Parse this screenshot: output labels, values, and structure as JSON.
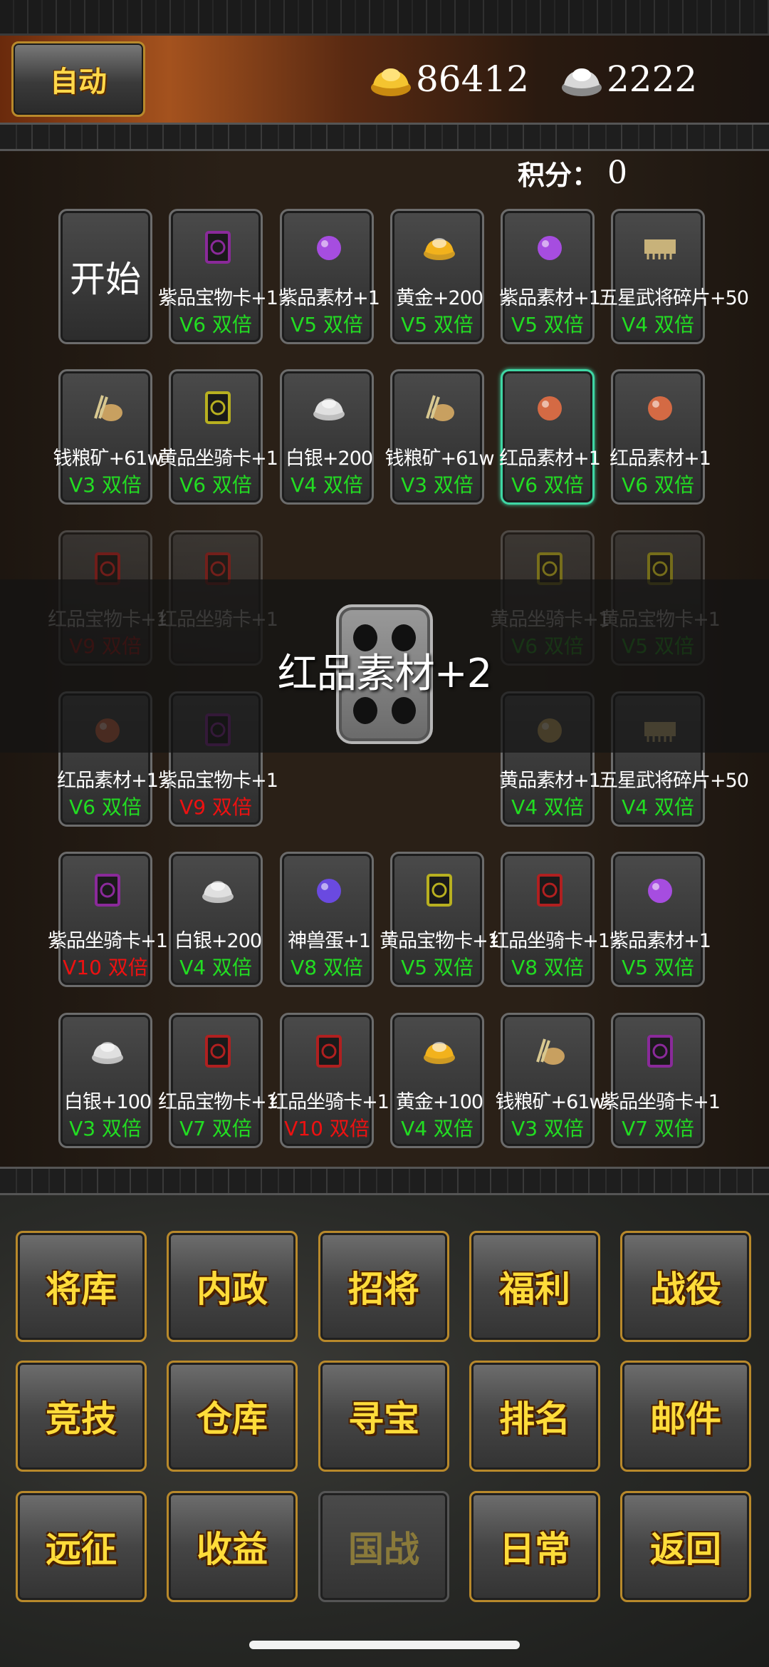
{
  "header": {
    "auto_label": "自动",
    "gold": "86412",
    "silver": "2222",
    "score_label": "积分：",
    "score_value": "0"
  },
  "board": {
    "start_label": "开始",
    "result_text": "红品素材+2",
    "dice_face": 4,
    "cells": [
      {
        "name": "紫品宝物卡+1",
        "mult": "V6 双倍",
        "mult_color": "green",
        "icon": "purple-treasure-card-icon",
        "icon_color": "#8a2a9a"
      },
      {
        "name": "紫品素材+1",
        "mult": "V5 双倍",
        "mult_color": "green",
        "icon": "purple-gem-icon",
        "icon_color": "#a64de0"
      },
      {
        "name": "黄金+200",
        "mult": "V5 双倍",
        "mult_color": "green",
        "icon": "gold-ingot-icon",
        "icon_color": "#f2b21c"
      },
      {
        "name": "紫品素材+1",
        "mult": "V5 双倍",
        "mult_color": "green",
        "icon": "purple-gem-icon",
        "icon_color": "#a64de0"
      },
      {
        "name": "五星武将碎片+50",
        "mult": "V4 双倍",
        "mult_color": "green",
        "icon": "general-fragment-icon",
        "icon_color": "#c8b27a"
      },
      {
        "name": "钱粮矿+61w",
        "mult": "V3 双倍",
        "mult_color": "green",
        "icon": "grain-ore-icon",
        "icon_color": "#c8a060"
      },
      {
        "name": "黄品坐骑卡+1",
        "mult": "V6 双倍",
        "mult_color": "green",
        "icon": "yellow-mount-card-icon",
        "icon_color": "#b8b020"
      },
      {
        "name": "白银+200",
        "mult": "V4 双倍",
        "mult_color": "green",
        "icon": "silver-ingot-icon",
        "icon_color": "#e0e0e0"
      },
      {
        "name": "钱粮矿+61w",
        "mult": "V3 双倍",
        "mult_color": "green",
        "icon": "grain-ore-icon",
        "icon_color": "#c8a060"
      },
      {
        "name": "红品素材+1",
        "mult": "V6 双倍",
        "mult_color": "green",
        "icon": "red-gem-icon",
        "icon_color": "#d46a44",
        "selected": true
      },
      {
        "name": "红品素材+1",
        "mult": "V6 双倍",
        "mult_color": "green",
        "icon": "red-gem-icon",
        "icon_color": "#d46a44"
      },
      {
        "name": "红品宝物卡+1",
        "mult": "V9 双倍",
        "mult_color": "red",
        "icon": "red-treasure-card-icon",
        "icon_color": "#b02020"
      },
      {
        "name": "红品坐骑卡+1",
        "mult": "",
        "mult_color": "green",
        "icon": "red-mount-card-icon",
        "icon_color": "#b02020"
      },
      {
        "name": "黄品坐骑卡+1",
        "mult": "V6 双倍",
        "mult_color": "green",
        "icon": "yellow-mount-card-icon",
        "icon_color": "#b8b020"
      },
      {
        "name": "黄品宝物卡+1",
        "mult": "V5 双倍",
        "mult_color": "green",
        "icon": "yellow-treasure-card-icon",
        "icon_color": "#b8b020"
      },
      {
        "name": "红品素材+1",
        "mult": "V6 双倍",
        "mult_color": "green",
        "icon": "red-gem-icon",
        "icon_color": "#d46a44"
      },
      {
        "name": "紫品宝物卡+1",
        "mult": "V9 双倍",
        "mult_color": "red",
        "icon": "purple-treasure-card-icon",
        "icon_color": "#8a2a9a"
      },
      {
        "name": "黄品素材+1",
        "mult": "V4 双倍",
        "mult_color": "green",
        "icon": "yellow-gem-icon",
        "icon_color": "#c8a860"
      },
      {
        "name": "五星武将碎片+50",
        "mult": "V4 双倍",
        "mult_color": "green",
        "icon": "general-fragment-icon",
        "icon_color": "#c8b27a"
      },
      {
        "name": "紫品坐骑卡+1",
        "mult": "V10 双倍",
        "mult_color": "red",
        "icon": "purple-mount-card-icon",
        "icon_color": "#8a2a9a"
      },
      {
        "name": "白银+200",
        "mult": "V4 双倍",
        "mult_color": "green",
        "icon": "silver-ingot-icon",
        "icon_color": "#e0e0e0"
      },
      {
        "name": "神兽蛋+1",
        "mult": "V8 双倍",
        "mult_color": "green",
        "icon": "beast-egg-icon",
        "icon_color": "#6a4ae0"
      },
      {
        "name": "黄品宝物卡+1",
        "mult": "V5 双倍",
        "mult_color": "green",
        "icon": "yellow-treasure-card-icon",
        "icon_color": "#b8b020"
      },
      {
        "name": "红品坐骑卡+1",
        "mult": "V8 双倍",
        "mult_color": "green",
        "icon": "red-mount-card-icon",
        "icon_color": "#b02020"
      },
      {
        "name": "紫品素材+1",
        "mult": "V5 双倍",
        "mult_color": "green",
        "icon": "purple-gem-icon",
        "icon_color": "#a64de0"
      },
      {
        "name": "白银+100",
        "mult": "V3 双倍",
        "mult_color": "green",
        "icon": "silver-ingot-icon",
        "icon_color": "#e0e0e0"
      },
      {
        "name": "红品宝物卡+1",
        "mult": "V7 双倍",
        "mult_color": "green",
        "icon": "red-treasure-card-icon",
        "icon_color": "#b02020"
      },
      {
        "name": "红品坐骑卡+1",
        "mult": "V10 双倍",
        "mult_color": "red",
        "icon": "red-mount-card-icon",
        "icon_color": "#b02020"
      },
      {
        "name": "黄金+100",
        "mult": "V4 双倍",
        "mult_color": "green",
        "icon": "gold-ingot-icon",
        "icon_color": "#f2b21c"
      },
      {
        "name": "钱粮矿+61w",
        "mult": "V3 双倍",
        "mult_color": "green",
        "icon": "grain-ore-icon",
        "icon_color": "#c8a060"
      },
      {
        "name": "紫品坐骑卡+1",
        "mult": "V7 双倍",
        "mult_color": "green",
        "icon": "purple-mount-card-icon",
        "icon_color": "#8a2a9a"
      }
    ]
  },
  "menu": {
    "buttons": [
      {
        "label": "将库",
        "enabled": true
      },
      {
        "label": "内政",
        "enabled": true
      },
      {
        "label": "招将",
        "enabled": true
      },
      {
        "label": "福利",
        "enabled": true
      },
      {
        "label": "战役",
        "enabled": true
      },
      {
        "label": "竞技",
        "enabled": true
      },
      {
        "label": "仓库",
        "enabled": true
      },
      {
        "label": "寻宝",
        "enabled": true
      },
      {
        "label": "排名",
        "enabled": true
      },
      {
        "label": "邮件",
        "enabled": true
      },
      {
        "label": "远征",
        "enabled": true
      },
      {
        "label": "收益",
        "enabled": true
      },
      {
        "label": "国战",
        "enabled": false
      },
      {
        "label": "日常",
        "enabled": true
      },
      {
        "label": "返回",
        "enabled": true
      }
    ]
  }
}
